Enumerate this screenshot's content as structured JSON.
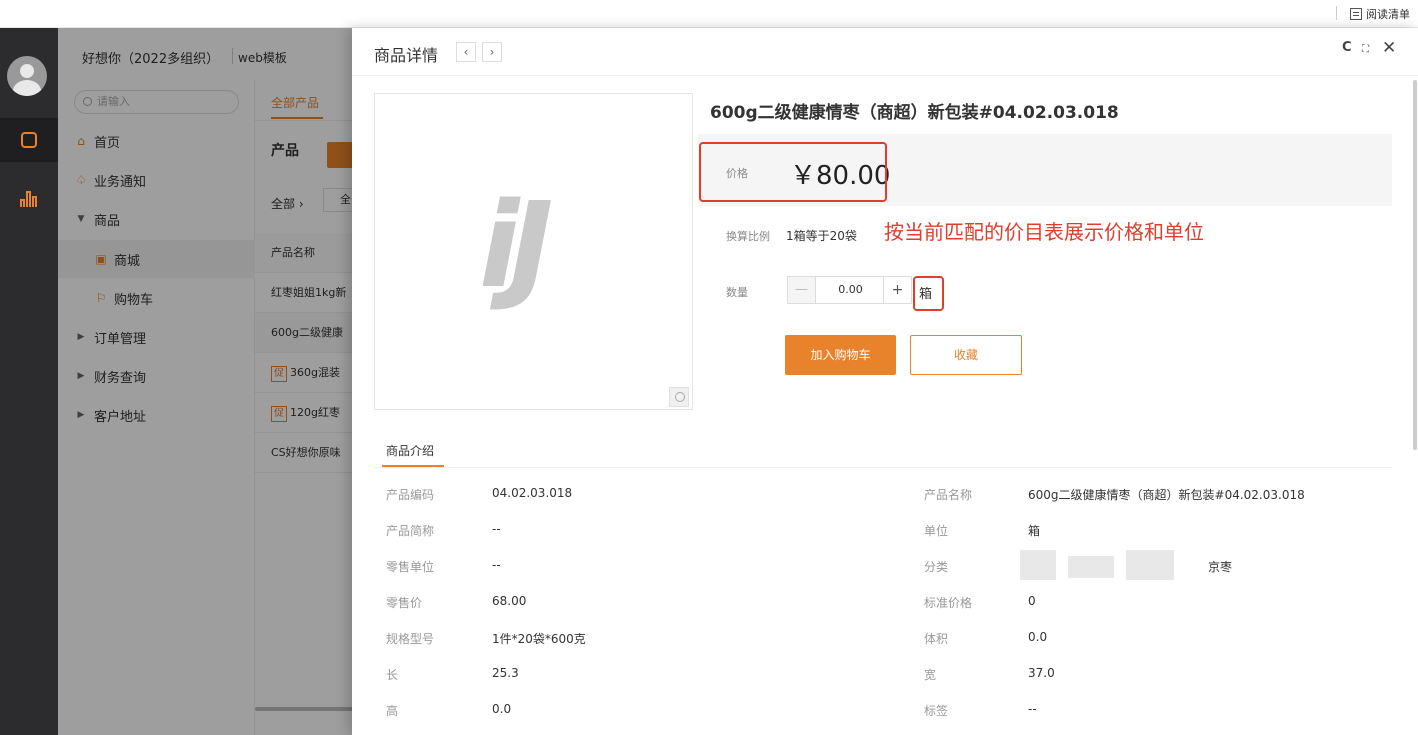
{
  "topbar": {
    "reading_list": "阅读清单"
  },
  "app": {
    "org_name": "好想你（2022多组织）",
    "template_name": "web模板",
    "search_placeholder": "请输入",
    "nav": {
      "home": "首页",
      "notice": "业务通知",
      "goods": "商品",
      "mall": "商城",
      "cart": "购物车",
      "orders": "订单管理",
      "finance": "财务查询",
      "address": "客户地址"
    },
    "collapse": "«",
    "main_tab": "全部产品",
    "main_title": "产品",
    "crumb": "全部 ›",
    "crumb_box": "全",
    "col_product_name": "产品名称",
    "rows": [
      {
        "promo": "",
        "text": "红枣姐姐1kg新"
      },
      {
        "promo": "",
        "text": "600g二级健康"
      },
      {
        "promo": "促",
        "text": "360g混装"
      },
      {
        "promo": "促",
        "text": "120g红枣"
      },
      {
        "promo": "",
        "text": "CS好想你原味"
      }
    ]
  },
  "modal": {
    "title": "商品详情",
    "prev": "‹",
    "next": "›",
    "refresh": "C",
    "expand": "⛶",
    "close": "✕",
    "image_logo": "iJ",
    "product_name": "600g二级健康情枣（商超）新包装#04.02.03.018",
    "price_label": "价格",
    "price": "￥80.00",
    "ratio_label": "换算比例",
    "ratio": "1箱等于20袋",
    "annotation": "按当前匹配的价目表展示价格和单位",
    "qty_label": "数量",
    "qty_minus": "—",
    "qty_value": "0.00",
    "qty_plus": "+",
    "unit": "箱",
    "add_to_cart": "加入购物车",
    "favorite": "收藏",
    "intro_tab": "商品介绍",
    "attrs_left": [
      {
        "label": "产品编码",
        "value": "04.02.03.018"
      },
      {
        "label": "产品简称",
        "value": "--"
      },
      {
        "label": "零售单位",
        "value": "--"
      },
      {
        "label": "零售价",
        "value": "68.00"
      },
      {
        "label": "规格型号",
        "value": "1件*20袋*600克"
      },
      {
        "label": "长",
        "value": "25.3"
      },
      {
        "label": "高",
        "value": "0.0"
      }
    ],
    "attrs_right": [
      {
        "label": "产品名称",
        "value": "600g二级健康情枣（商超）新包装#04.02.03.018"
      },
      {
        "label": "单位",
        "value": "箱"
      },
      {
        "label": "分类",
        "value": "京枣"
      },
      {
        "label": "标准价格",
        "value": "0"
      },
      {
        "label": "体积",
        "value": "0.0"
      },
      {
        "label": "宽",
        "value": "37.0"
      },
      {
        "label": "标签",
        "value": "--"
      }
    ]
  },
  "colors": {
    "accent": "#e8822b",
    "annotation_red": "#e03e2d",
    "rail": "#2c2c2e"
  }
}
